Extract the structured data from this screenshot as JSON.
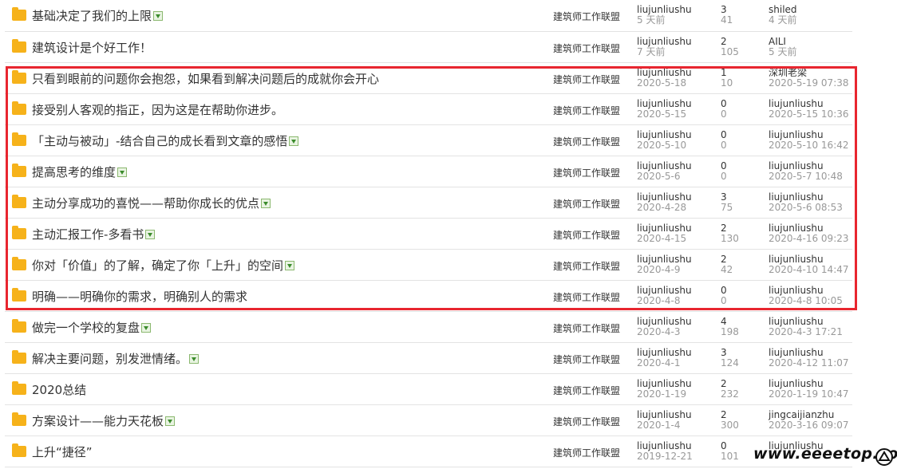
{
  "threads": [
    {
      "title": "基础决定了我们的上限",
      "has_image": true,
      "forum": "建筑师工作联盟",
      "author": "liujunliushu",
      "date": "5 天前",
      "replies": "3",
      "views": "41",
      "last_user": "shiled",
      "last_time": "4 天前"
    },
    {
      "title": "建筑设计是个好工作！",
      "has_image": false,
      "forum": "建筑师工作联盟",
      "author": "liujunliushu",
      "date": "7 天前",
      "replies": "2",
      "views": "105",
      "last_user": "AILI",
      "last_time": "5 天前"
    },
    {
      "title": "只看到眼前的问题你会抱怨，如果看到解决问题后的成就你会开心",
      "has_image": false,
      "forum": "建筑师工作联盟",
      "author": "liujunliushu",
      "date": "2020-5-18",
      "replies": "1",
      "views": "10",
      "last_user": "深圳老梁",
      "last_time": "2020-5-19 07:38"
    },
    {
      "title": "接受别人客观的指正，因为这是在帮助你进步。",
      "has_image": false,
      "forum": "建筑师工作联盟",
      "author": "liujunliushu",
      "date": "2020-5-15",
      "replies": "0",
      "views": "0",
      "last_user": "liujunliushu",
      "last_time": "2020-5-15 10:36"
    },
    {
      "title": "「主动与被动」-结合自己的成长看到文章的感悟",
      "has_image": true,
      "forum": "建筑师工作联盟",
      "author": "liujunliushu",
      "date": "2020-5-10",
      "replies": "0",
      "views": "0",
      "last_user": "liujunliushu",
      "last_time": "2020-5-10 16:42"
    },
    {
      "title": "提高思考的维度",
      "has_image": true,
      "forum": "建筑师工作联盟",
      "author": "liujunliushu",
      "date": "2020-5-6",
      "replies": "0",
      "views": "0",
      "last_user": "liujunliushu",
      "last_time": "2020-5-7 10:48"
    },
    {
      "title": "主动分享成功的喜悦——帮助你成长的优点",
      "has_image": true,
      "forum": "建筑师工作联盟",
      "author": "liujunliushu",
      "date": "2020-4-28",
      "replies": "3",
      "views": "75",
      "last_user": "liujunliushu",
      "last_time": "2020-5-6 08:53"
    },
    {
      "title": "主动汇报工作-多看书",
      "has_image": true,
      "forum": "建筑师工作联盟",
      "author": "liujunliushu",
      "date": "2020-4-15",
      "replies": "2",
      "views": "130",
      "last_user": "liujunliushu",
      "last_time": "2020-4-16 09:23"
    },
    {
      "title": "你对「价值」的了解，确定了你「上升」的空间",
      "has_image": true,
      "forum": "建筑师工作联盟",
      "author": "liujunliushu",
      "date": "2020-4-9",
      "replies": "2",
      "views": "42",
      "last_user": "liujunliushu",
      "last_time": "2020-4-10 14:47"
    },
    {
      "title": "明确——明确你的需求，明确别人的需求",
      "has_image": false,
      "forum": "建筑师工作联盟",
      "author": "liujunliushu",
      "date": "2020-4-8",
      "replies": "0",
      "views": "0",
      "last_user": "liujunliushu",
      "last_time": "2020-4-8 10:05"
    },
    {
      "title": "做完一个学校的复盘",
      "has_image": true,
      "forum": "建筑师工作联盟",
      "author": "liujunliushu",
      "date": "2020-4-3",
      "replies": "4",
      "views": "198",
      "last_user": "liujunliushu",
      "last_time": "2020-4-3 17:21"
    },
    {
      "title": "解决主要问题，别发泄情绪。",
      "has_image": true,
      "forum": "建筑师工作联盟",
      "author": "liujunliushu",
      "date": "2020-4-1",
      "replies": "3",
      "views": "124",
      "last_user": "liujunliushu",
      "last_time": "2020-4-12 11:07"
    },
    {
      "title": "2020总结",
      "has_image": false,
      "forum": "建筑师工作联盟",
      "author": "liujunliushu",
      "date": "2020-1-19",
      "replies": "2",
      "views": "232",
      "last_user": "liujunliushu",
      "last_time": "2020-1-19 10:47"
    },
    {
      "title": "方案设计——能力天花板",
      "has_image": true,
      "forum": "建筑师工作联盟",
      "author": "liujunliushu",
      "date": "2020-1-4",
      "replies": "2",
      "views": "300",
      "last_user": "jingcaijianzhu",
      "last_time": "2020-3-16 09:07"
    },
    {
      "title": "上升“捷径”",
      "has_image": false,
      "forum": "建筑师工作联盟",
      "author": "liujunliushu",
      "date": "2019-12-21",
      "replies": "0",
      "views": "101",
      "last_user": "liujunliushu",
      "last_time": ""
    }
  ],
  "watermark": "www.eeeetop.com",
  "colors": {
    "highlight": "#e8262f",
    "folder": "#f6b21a",
    "muted": "#999999"
  }
}
